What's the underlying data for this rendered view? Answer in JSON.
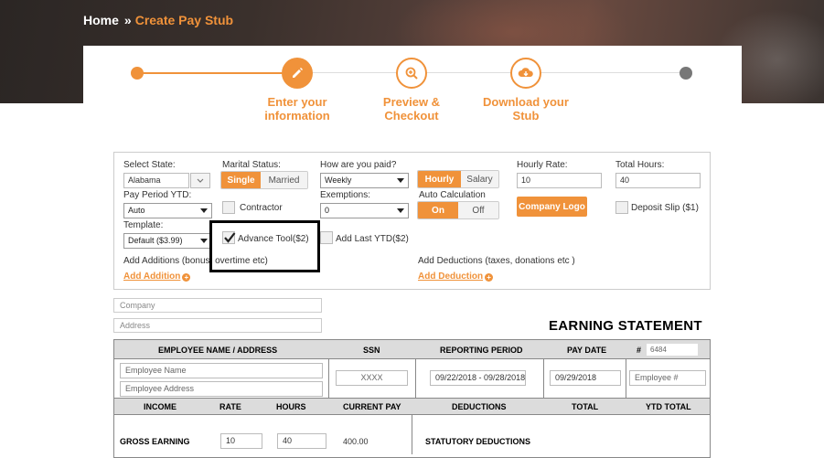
{
  "breadcrumb": {
    "home": "Home",
    "separator": "»",
    "current": "Create Pay Stub"
  },
  "steps": [
    {
      "label_line1": "Enter your",
      "label_line2": "information",
      "icon": "pencil-icon"
    },
    {
      "label_line1": "Preview &",
      "label_line2": "Checkout",
      "icon": "magnify-plus-icon"
    },
    {
      "label_line1": "Download your",
      "label_line2": "Stub",
      "icon": "cloud-download-icon"
    }
  ],
  "form": {
    "state_label": "Select State:",
    "state_value": "Alabama",
    "marital_label": "Marital Status:",
    "marital_options": [
      "Single",
      "Married"
    ],
    "pay_freq_label": "How are you paid?",
    "pay_freq_value": "Weekly",
    "pay_type_options": [
      "Hourly",
      "Salary"
    ],
    "hourly_rate_label": "Hourly Rate:",
    "hourly_rate_value": "10",
    "total_hours_label": "Total Hours:",
    "total_hours_value": "40",
    "pay_period_ytd_label": "Pay Period YTD:",
    "pay_period_ytd_value": "Auto",
    "contractor_label": "Contractor",
    "exemptions_label": "Exemptions:",
    "exemptions_value": "0",
    "auto_calc_label": "Auto Calculation",
    "auto_calc_options": [
      "On",
      "Off"
    ],
    "company_logo_label": "Company Logo",
    "deposit_slip_label": "Deposit Slip ($1)",
    "template_label": "Template:",
    "template_value": "Default ($3.99)",
    "advance_tool_label": "Advance Tool($2)",
    "add_last_ytd_label": "Add Last YTD($2)",
    "additions_text": "Add Additions (bonus, overtime etc)",
    "add_addition_link": "Add Addition",
    "deductions_text": "Add Deductions (taxes, donations etc )",
    "add_deduction_link": "Add Deduction"
  },
  "company": {
    "company_placeholder": "Company",
    "address_placeholder": "Address"
  },
  "statement": {
    "title": "EARNING STATEMENT",
    "headers": {
      "employee": "EMPLOYEE NAME / ADDRESS",
      "ssn": "SSN",
      "period": "REPORTING PERIOD",
      "pay_date": "PAY DATE",
      "number": "#",
      "number_value": "6484"
    },
    "employee_name_placeholder": "Employee Name",
    "employee_address_placeholder": "Employee Address",
    "ssn_placeholder": "XXXX",
    "period_value": "09/22/2018 - 09/28/2018",
    "pay_date_value": "09/29/2018",
    "employee_number_placeholder": "Employee #",
    "earnings_headers": {
      "income": "INCOME",
      "rate": "RATE",
      "hours": "HOURS",
      "current_pay": "CURRENT PAY",
      "deductions": "DEDUCTIONS",
      "total": "TOTAL",
      "ytd_total": "YTD TOTAL"
    },
    "gross_label": "GROSS EARNING",
    "gross_rate": "10",
    "gross_hours": "40",
    "gross_current": "400.00",
    "statutory_label": "STATUTORY DEDUCTIONS"
  },
  "colors": {
    "accent": "#f0923a",
    "header_gray": "#dcdcdc"
  }
}
